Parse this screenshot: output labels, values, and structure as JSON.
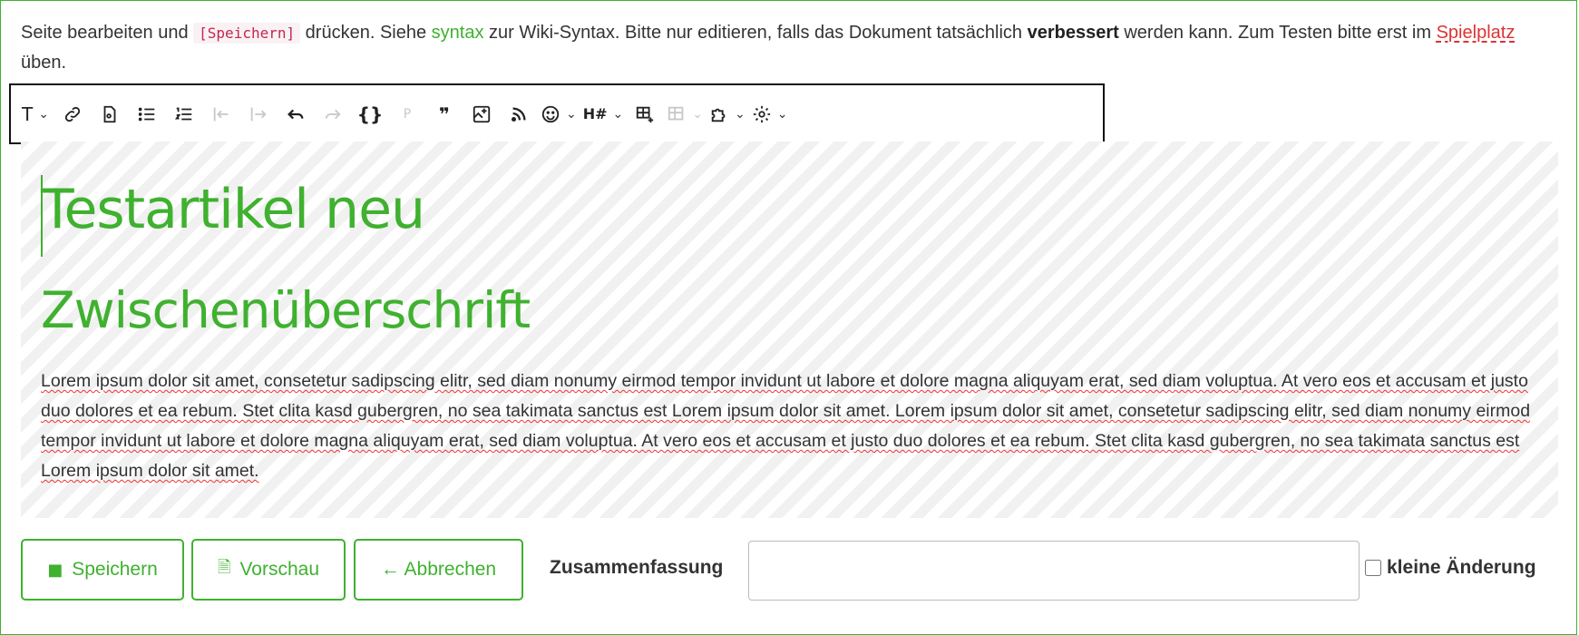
{
  "intro": {
    "part1": "Seite bearbeiten und ",
    "code": "[Speichern]",
    "part2": " drücken. Siehe ",
    "syntax_link": "syntax",
    "part3": " zur Wiki-Syntax. Bitte nur editieren, falls das Dokument tatsächlich ",
    "bold": "verbessert",
    "part4": " werden kann. Zum Testen bitte erst im ",
    "playground_link": "Spielplatz",
    "part5": " üben."
  },
  "toolbar": {
    "items": [
      {
        "icon": "text-format-icon",
        "glyph": "T",
        "dropdown": true
      },
      {
        "icon": "link-icon",
        "glyph": "🔗"
      },
      {
        "icon": "media-file-icon",
        "glyph": "🗎"
      },
      {
        "icon": "bullet-list-icon",
        "glyph": "☰"
      },
      {
        "icon": "numbered-list-icon",
        "glyph": "⋮☰"
      },
      {
        "icon": "outdent-icon",
        "glyph": "⇤",
        "disabled": true
      },
      {
        "icon": "indent-icon",
        "glyph": "⇥",
        "disabled": true
      },
      {
        "icon": "undo-icon",
        "glyph": "↶"
      },
      {
        "icon": "redo-icon",
        "glyph": "↷",
        "disabled": true
      },
      {
        "icon": "code-braces-icon",
        "glyph": "{}"
      },
      {
        "icon": "paragraph-icon",
        "glyph": "P",
        "disabled": true
      },
      {
        "icon": "blockquote-icon",
        "glyph": "❞"
      },
      {
        "icon": "insert-image-icon",
        "glyph": "⊞"
      },
      {
        "icon": "rss-icon",
        "glyph": "⊳"
      },
      {
        "icon": "emoji-icon",
        "glyph": "☺",
        "dropdown": true
      },
      {
        "icon": "heading-hash-icon",
        "glyph": "H#",
        "dropdown": true
      },
      {
        "icon": "table-insert-icon",
        "glyph": "⊞",
        "dropdown": false
      },
      {
        "icon": "table-edit-icon",
        "glyph": "⊟",
        "disabled": true,
        "dropdown": true
      },
      {
        "icon": "plugin-puzzle-icon",
        "glyph": "✲",
        "dropdown": true
      },
      {
        "icon": "settings-gear-icon",
        "glyph": "⚙",
        "dropdown": true
      }
    ]
  },
  "editor": {
    "h1": "Testartikel neu",
    "h2": "Zwischenüberschrift",
    "paragraph": "Lorem ipsum dolor sit amet, consetetur sadipscing elitr, sed diam nonumy eirmod tempor invidunt ut labore et dolore magna aliquyam erat, sed diam voluptua. At vero eos et accusam et justo duo dolores et ea rebum. Stet clita kasd gubergren, no sea takimata sanctus est Lorem ipsum dolor sit amet. Lorem ipsum dolor sit amet, consetetur sadipscing elitr, sed diam nonumy eirmod tempor invidunt ut labore et dolore magna aliquyam erat, sed diam voluptua. At vero eos et accusam et justo duo dolores et ea rebum. Stet clita kasd gubergren, no sea takimata sanctus est Lorem ipsum dolor sit amet."
  },
  "actions": {
    "save_label": "Speichern",
    "preview_label": "Vorschau",
    "cancel_label": "← Abbrechen",
    "summary_label": "Zusammenfassung",
    "summary_value": "",
    "minor_change_label": "kleine Änderung"
  },
  "colors": {
    "accent": "#3fb12f",
    "link_red": "#dd3333",
    "code": "#c7254e"
  }
}
